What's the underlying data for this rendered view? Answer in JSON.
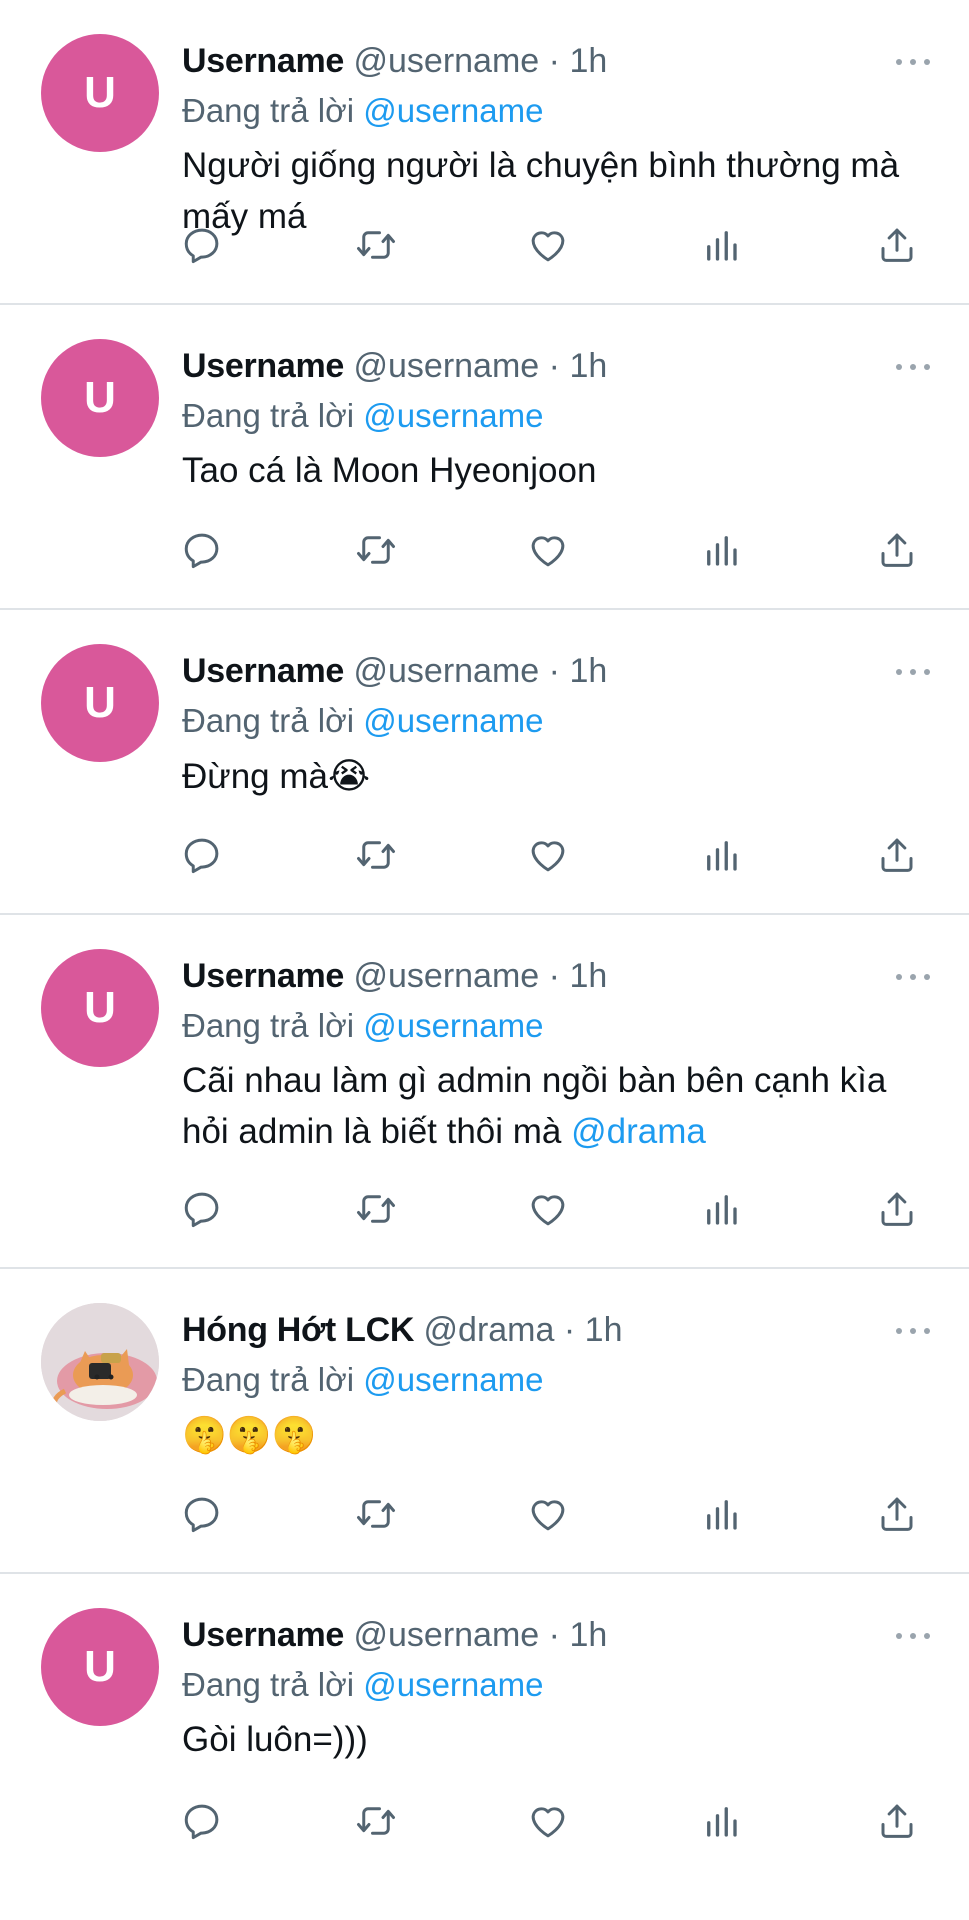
{
  "tweets": [
    {
      "avatar_letter": "U",
      "name": "Username",
      "handle": "@username",
      "time": "1h",
      "reply_prefix": "Đang trả lời",
      "reply_to": "@username",
      "text_lines": [
        "Người giống người là chuyện bình thường mà",
        "mấy má"
      ]
    },
    {
      "avatar_letter": "U",
      "name": "Username",
      "handle": "@username",
      "time": "1h",
      "reply_prefix": "Đang trả lời",
      "reply_to": "@username",
      "text_lines": [
        "Tao cá là Moon Hyeonjoon"
      ]
    },
    {
      "avatar_letter": "U",
      "name": "Username",
      "handle": "@username",
      "time": "1h",
      "reply_prefix": "Đang trả lời",
      "reply_to": "@username",
      "text": "Đừng mà",
      "emoji": "😭"
    },
    {
      "avatar_letter": "U",
      "name": "Username",
      "handle": "@username",
      "time": "1h",
      "reply_prefix": "Đang trả lời",
      "reply_to": "@username",
      "text_line1": "Cãi nhau làm gì admin ngồi bàn bên cạnh kìa",
      "text_line2": "hỏi admin là biết thôi mà",
      "mention": "@drama"
    },
    {
      "avatar_icon": "cat-avatar-image",
      "name": "Hóng Hớt LCK",
      "handle": "@drama",
      "time": "1h",
      "reply_prefix": "Đang trả lời",
      "reply_to": "@username",
      "emoji": "🤫🤫🤫"
    },
    {
      "avatar_letter": "U",
      "name": "Username",
      "handle": "@username",
      "time": "1h",
      "reply_prefix": "Đang trả lời",
      "reply_to": "@username",
      "text": "Gòi luôn=)))"
    }
  ],
  "separator": "·",
  "icons": [
    "reply-icon",
    "retweet-icon",
    "like-icon",
    "views-icon",
    "share-icon",
    "more-icon"
  ],
  "colors": {
    "avatar": "#d9589a",
    "mention": "#1d9bf0",
    "secondary_text": "#536471",
    "divider": "#dfe3e7"
  }
}
